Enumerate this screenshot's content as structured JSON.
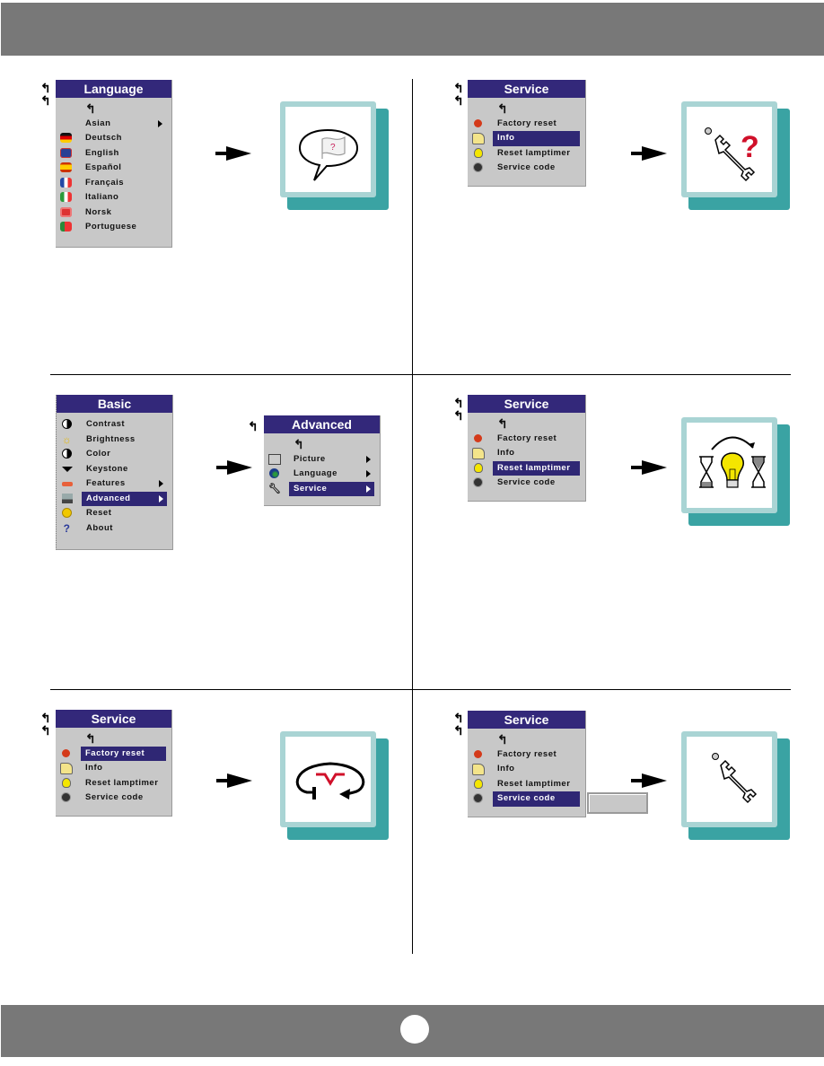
{
  "page": {
    "header_bar_color": "#787878",
    "footer_bar_color": "#787878"
  },
  "panels": {
    "language": {
      "menu": {
        "title": "Language",
        "back_glyph": "↰",
        "items": [
          {
            "label": "Asian",
            "icon": "none",
            "submenu": true,
            "selected": false
          },
          {
            "label": "Deutsch",
            "icon": "flag-germany-icon",
            "submenu": false,
            "selected": false
          },
          {
            "label": "English",
            "icon": "flag-uk-icon",
            "submenu": false,
            "selected": false
          },
          {
            "label": "Español",
            "icon": "flag-spain-icon",
            "submenu": false,
            "selected": false
          },
          {
            "label": "Français",
            "icon": "flag-france-icon",
            "submenu": false,
            "selected": false
          },
          {
            "label": "Italiano",
            "icon": "flag-italy-icon",
            "submenu": false,
            "selected": false
          },
          {
            "label": "Norsk",
            "icon": "flag-norway-icon",
            "submenu": false,
            "selected": false
          },
          {
            "label": "Portuguese",
            "icon": "flag-portugal-icon",
            "submenu": false,
            "selected": false
          }
        ]
      },
      "result_icon": "speech-bubble-flag-question-icon",
      "result_glyph": "?"
    },
    "service_info": {
      "menu": {
        "title": "Service",
        "items": [
          {
            "label": "Factory reset",
            "icon": "factory-reset-icon",
            "selected": false
          },
          {
            "label": "Info",
            "icon": "info-icon",
            "selected": true
          },
          {
            "label": "Reset lamptimer",
            "icon": "lamp-icon",
            "selected": false
          },
          {
            "label": "Service code",
            "icon": "lock-icon",
            "selected": false
          }
        ]
      },
      "result_icon": "wrench-question-icon",
      "result_glyph": "?"
    },
    "basic": {
      "menu": {
        "title": "Basic",
        "items": [
          {
            "label": "Contrast",
            "icon": "contrast-icon",
            "submenu": false,
            "selected": false
          },
          {
            "label": "Brightness",
            "icon": "brightness-icon",
            "submenu": false,
            "selected": false
          },
          {
            "label": "Color",
            "icon": "color-icon",
            "submenu": false,
            "selected": false
          },
          {
            "label": "Keystone",
            "icon": "keystone-icon",
            "submenu": false,
            "selected": false
          },
          {
            "label": "Features",
            "icon": "features-icon",
            "submenu": true,
            "selected": false
          },
          {
            "label": "Advanced",
            "icon": "advanced-icon",
            "submenu": true,
            "selected": true
          },
          {
            "label": "Reset",
            "icon": "reset-icon",
            "submenu": false,
            "selected": false
          },
          {
            "label": "About",
            "icon": "about-icon",
            "submenu": false,
            "selected": false
          }
        ]
      },
      "advanced_menu": {
        "title": "Advanced",
        "items": [
          {
            "label": "Picture",
            "icon": "picture-icon",
            "submenu": true,
            "selected": false
          },
          {
            "label": "Language",
            "icon": "globe-icon",
            "submenu": true,
            "selected": false
          },
          {
            "label": "Service",
            "icon": "wrench-icon",
            "submenu": true,
            "selected": true
          }
        ]
      }
    },
    "service_lamptimer": {
      "menu": {
        "title": "Service",
        "items": [
          {
            "label": "Factory reset",
            "icon": "factory-reset-icon",
            "selected": false
          },
          {
            "label": "Info",
            "icon": "info-icon",
            "selected": false
          },
          {
            "label": "Reset lamptimer",
            "icon": "lamp-icon",
            "selected": true
          },
          {
            "label": "Service code",
            "icon": "lock-icon",
            "selected": false
          }
        ]
      },
      "result_icon": "hourglass-lamp-reset-icon"
    },
    "service_factory": {
      "menu": {
        "title": "Service",
        "items": [
          {
            "label": "Factory reset",
            "icon": "factory-reset-icon",
            "selected": true
          },
          {
            "label": "Info",
            "icon": "info-icon",
            "selected": false
          },
          {
            "label": "Reset lamptimer",
            "icon": "lamp-icon",
            "selected": false
          },
          {
            "label": "Service code",
            "icon": "lock-icon",
            "selected": false
          }
        ]
      },
      "result_icon": "factory-reset-loop-icon"
    },
    "service_code": {
      "menu": {
        "title": "Service",
        "items": [
          {
            "label": "Factory reset",
            "icon": "factory-reset-icon",
            "selected": false
          },
          {
            "label": "Info",
            "icon": "info-icon",
            "selected": false
          },
          {
            "label": "Reset lamptimer",
            "icon": "lamp-icon",
            "selected": false
          },
          {
            "label": "Service code",
            "icon": "lock-icon",
            "selected": true
          }
        ]
      },
      "code_input_value": "",
      "result_icon": "wrench-icon"
    }
  },
  "colors": {
    "menu_title_bg": "#33287a",
    "menu_body_bg": "#c8c8c8",
    "selection_bg": "#2f2774",
    "tile_face": "#a9d4d4",
    "tile_shadow": "#3aa3a3",
    "accent_red": "#d0102a"
  }
}
